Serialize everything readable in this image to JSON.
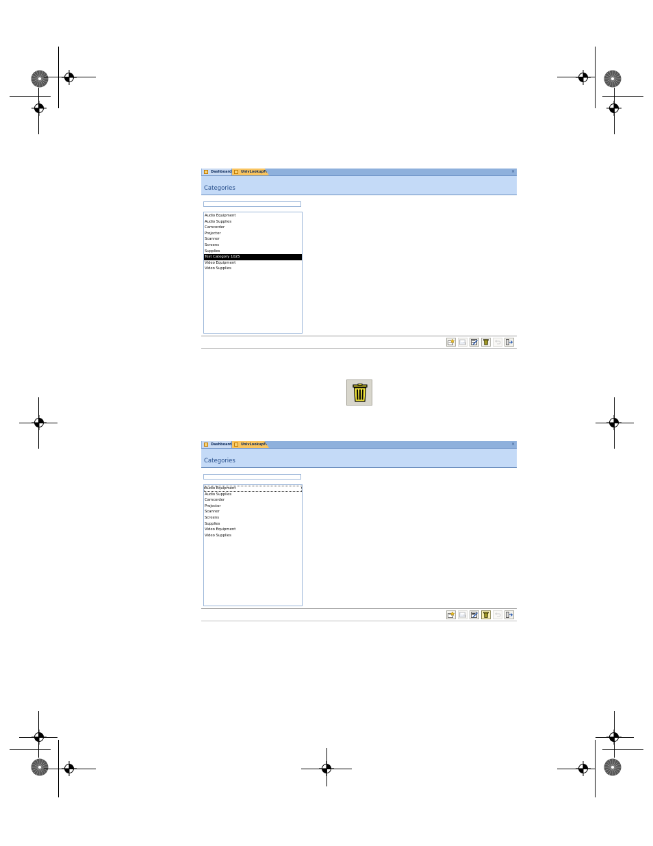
{
  "window_top": {
    "tabs": [
      {
        "label": "Dashboard",
        "icon": "form-icon",
        "active": false
      },
      {
        "label": "UnivLookupFrm",
        "icon": "form-icon",
        "active": true
      }
    ],
    "close_glyph": "×",
    "form_title": "Categories",
    "search_value": "",
    "list_items": [
      "Audio Equipment",
      "Audio Supplies",
      "Camcorder",
      "Projector",
      "Scanner",
      "Screens",
      "Supplies",
      "Test Category 1025",
      "Video Equipment",
      "Video Supplies"
    ],
    "selected_item": "Test Category 1025"
  },
  "window_bottom": {
    "tabs": [
      {
        "label": "Dashboard",
        "icon": "form-icon",
        "active": false
      },
      {
        "label": "UnivLookupFrm",
        "icon": "form-icon",
        "active": true
      }
    ],
    "close_glyph": "×",
    "form_title": "Categories",
    "search_value": "",
    "list_items": [
      "Audio Equipment",
      "Audio Supplies",
      "Camcorder",
      "Projector",
      "Scanner",
      "Screens",
      "Supplies",
      "Video Equipment",
      "Video Supplies"
    ],
    "focused_item": "Audio Equipment"
  },
  "toolbar_buttons": [
    {
      "name": "new-record-icon"
    },
    {
      "name": "save-record-icon"
    },
    {
      "name": "edit-record-icon"
    },
    {
      "name": "delete-record-icon"
    },
    {
      "name": "undo-icon"
    },
    {
      "name": "close-form-icon"
    }
  ],
  "callout": {
    "icon": "trash-can-icon"
  },
  "colors": {
    "tab_strip": "#8eb0dc",
    "active_tab": "#f9c45f",
    "form_header": "#c4daf7",
    "title_text": "#254d8a",
    "delete_yellow": "#f3e63a"
  }
}
